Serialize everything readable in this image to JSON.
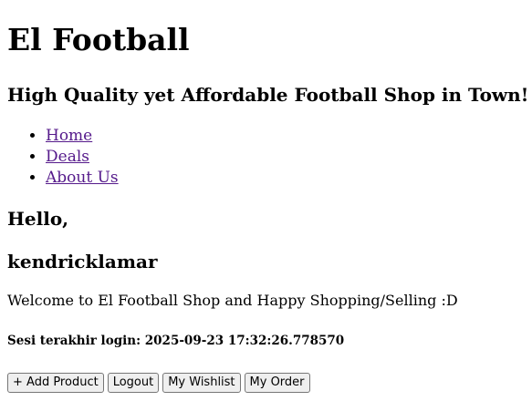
{
  "header": {
    "title": "El Football",
    "tagline": "High Quality yet Affordable Football Shop in Town!"
  },
  "nav": {
    "items": [
      {
        "label": "Home"
      },
      {
        "label": "Deals"
      },
      {
        "label": "About Us"
      }
    ]
  },
  "greeting": {
    "hello": "Hello,",
    "username": "kendricklamar",
    "welcome": "Welcome to El Football Shop and Happy Shopping/Selling :D",
    "last_login": "Sesi terakhir login: 2025-09-23 17:32:26.778570"
  },
  "actions": {
    "add_product": "+ Add Product",
    "logout": "Logout",
    "wishlist": "My Wishlist",
    "order": "My Order"
  },
  "colors": {
    "link": "#551a8b",
    "button_bg": "#efefef",
    "button_border": "#767676"
  }
}
